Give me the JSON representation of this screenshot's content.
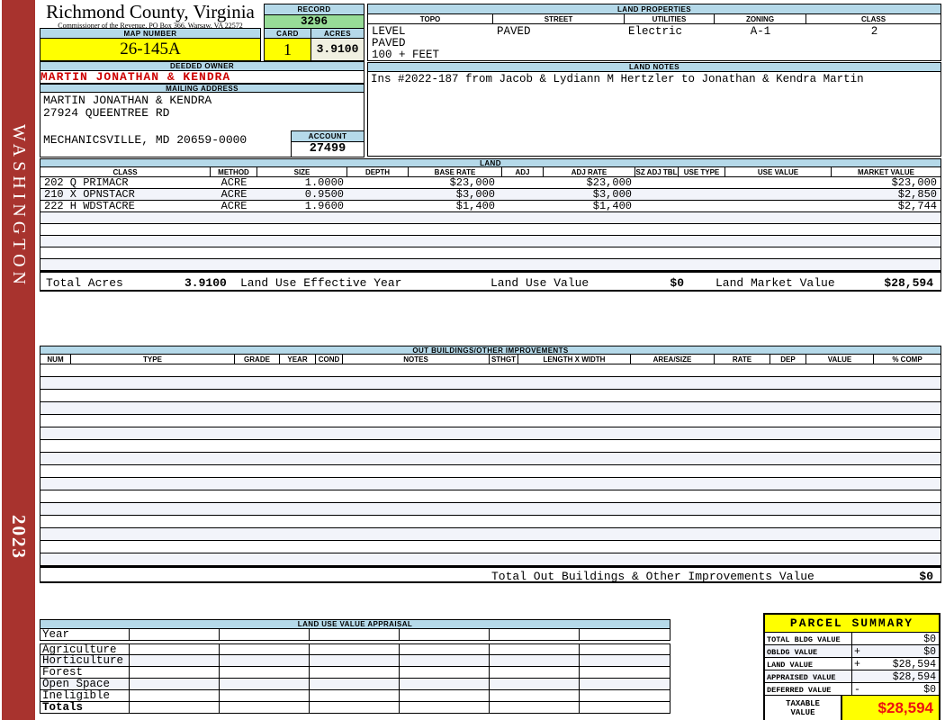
{
  "colors": {
    "header_blue": "#B5D9E9",
    "record_green": "#97DC97",
    "highlight_yellow": "#FFFF00",
    "acres_cream": "#F0F0E1",
    "sidebar_red": "#A8332E",
    "owner_red": "#CC0000",
    "taxable_red": "#EE1111"
  },
  "sidebar": {
    "state_label": "WASHINGTON",
    "year": "2023"
  },
  "header": {
    "title": "Richmond County, Virginia",
    "subtitle": "Commissioner of the Revenue, PO Box 366, Warsaw, VA 22572",
    "record_label": "RECORD",
    "record_value": "3296",
    "map_number_label": "MAP NUMBER",
    "map_number_value": "26-145A",
    "card_label": "CARD",
    "card_value": "1",
    "acres_label": "ACRES",
    "acres_value": "3.9100"
  },
  "land_properties": {
    "title": "LAND PROPERTIES",
    "columns": [
      "TOPO",
      "STREET",
      "UTILITIES",
      "ZONING",
      "CLASS"
    ],
    "values": {
      "topo": [
        "LEVEL",
        "PAVED",
        "100 + FEET"
      ],
      "street": "PAVED",
      "utilities": "Electric",
      "zoning": "A-1",
      "class": "2"
    }
  },
  "owner": {
    "deeded_owner_label": "DEEDED OWNER",
    "deeded_owner": "MARTIN JONATHAN & KENDRA",
    "mailing_address_label": "MAILING ADDRESS",
    "address_line1": "MARTIN JONATHAN & KENDRA",
    "address_line2": "27924 QUEENTREE RD",
    "address_line3": "MECHANICSVILLE, MD 20659-0000",
    "account_label": "ACCOUNT",
    "account_value": "27499"
  },
  "land_notes": {
    "title": "LAND NOTES",
    "note": "Ins #2022-187 from Jacob & Lydiann M Hertzler to Jonathan & Kendra Martin"
  },
  "land": {
    "title": "LAND",
    "columns": [
      "CLASS",
      "METHOD",
      "SIZE",
      "DEPTH",
      "BASE RATE",
      "ADJ",
      "ADJ RATE",
      "SZ ADJ TBL",
      "USE TYPE",
      "USE VALUE",
      "MARKET VALUE"
    ],
    "rows": [
      {
        "class": "202 Q PRIMACR",
        "method": "ACRE",
        "size": "1.0000",
        "base_rate": "$23,000",
        "adj_rate": "$23,000",
        "market_value": "$23,000"
      },
      {
        "class": "210 X OPNSTACR",
        "method": "ACRE",
        "size": "0.9500",
        "base_rate": "$3,000",
        "adj_rate": "$3,000",
        "market_value": "$2,850"
      },
      {
        "class": "222 H WDSTACRE",
        "method": "ACRE",
        "size": "1.9600",
        "base_rate": "$1,400",
        "adj_rate": "$1,400",
        "market_value": "$2,744"
      }
    ],
    "totals": {
      "total_acres_label": "Total Acres",
      "total_acres": "3.9100",
      "effective_year_label": "Land Use Effective Year",
      "use_value_label": "Land Use Value",
      "use_value": "$0",
      "market_value_label": "Land Market Value",
      "market_value": "$28,594"
    }
  },
  "out_buildings": {
    "title": "OUT BUILDINGS/OTHER IMPROVEMENTS",
    "columns": [
      "NUM",
      "TYPE",
      "GRADE",
      "YEAR",
      "COND",
      "NOTES",
      "STHGT",
      "LENGTH X WIDTH",
      "AREA/SIZE",
      "RATE",
      "DEP",
      "VALUE",
      "% COMP"
    ],
    "total_label": "Total Out Buildings & Other Improvements Value",
    "total_value": "$0"
  },
  "land_use_appraisal": {
    "title": "LAND USE VALUE APPRAISAL",
    "row_labels": [
      "Year",
      "Agriculture",
      "Horticulture",
      "Forest",
      "Open Space",
      "Ineligible",
      "Totals"
    ]
  },
  "parcel_summary": {
    "title": "PARCEL SUMMARY",
    "rows": [
      {
        "label": "TOTAL BLDG VALUE",
        "op": "",
        "value": "$0"
      },
      {
        "label": "OBLDG VALUE",
        "op": "+",
        "value": "$0"
      },
      {
        "label": "LAND VALUE",
        "op": "+",
        "value": "$28,594"
      },
      {
        "label": "APPRAISED VALUE",
        "op": "",
        "value": "$28,594"
      },
      {
        "label": "DEFERRED VALUE",
        "op": "-",
        "value": "$0"
      }
    ],
    "taxable_label": "TAXABLE VALUE",
    "taxable_value": "$28,594"
  }
}
